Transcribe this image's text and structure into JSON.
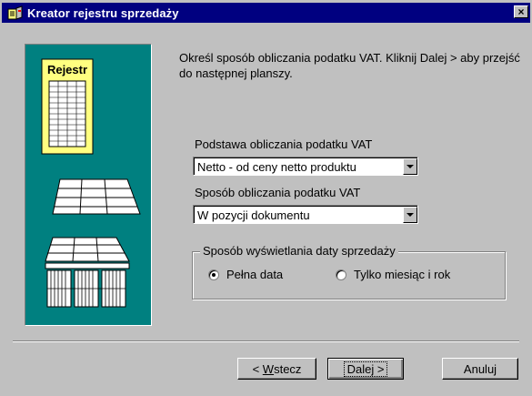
{
  "window": {
    "title": "Kreator rejestru sprzedaży",
    "close_glyph": "×"
  },
  "illustration": {
    "register_label": "Rejestr",
    "background_color": "#008080",
    "register_color": "#ffff80"
  },
  "intro_text": "Określ sposób obliczania podatku VAT. Kliknij Dalej > aby przejść do następnej planszy.",
  "vat_basis": {
    "label": "Podstawa obliczania podatku VAT",
    "value": "Netto - od ceny netto produktu"
  },
  "vat_method": {
    "label": "Sposób obliczania podatku VAT",
    "value": "W pozycji dokumentu"
  },
  "sale_date_display": {
    "legend": "Sposób wyświetlania daty sprzedaży",
    "options": [
      {
        "label": "Pełna data",
        "selected": true
      },
      {
        "label": "Tylko miesiąc i rok",
        "selected": false
      }
    ]
  },
  "buttons": {
    "back_prefix": "< ",
    "back_hotkey": "W",
    "back_rest": "stecz",
    "next": "Dalej >",
    "cancel": "Anuluj"
  },
  "colors": {
    "titlebar": "#000080",
    "face": "#c0c0c0"
  }
}
